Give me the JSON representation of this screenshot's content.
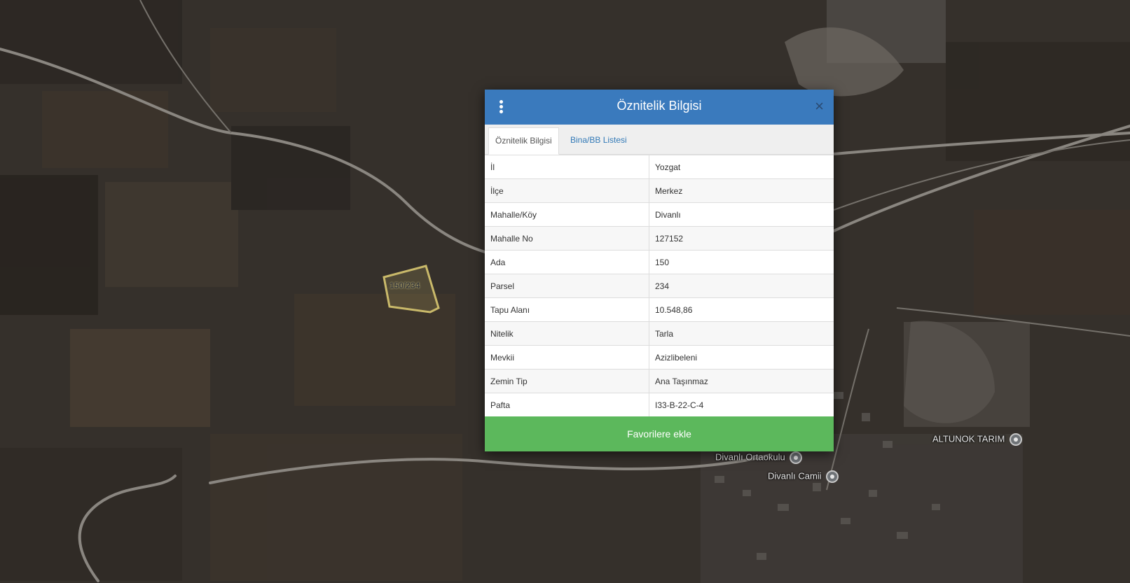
{
  "map": {
    "parcel_label": "150/234",
    "poi": [
      {
        "label": "ALTUNOK TARIM"
      },
      {
        "label": "Divanlı Ortaokulu"
      },
      {
        "label": "Divanlı Camii"
      }
    ]
  },
  "modal": {
    "title": "Öznitelik Bilgisi",
    "close_symbol": "×",
    "tabs": [
      {
        "label": "Öznitelik Bilgisi",
        "active": true
      },
      {
        "label": "Bina/BB Listesi",
        "active": false
      }
    ],
    "rows": [
      {
        "key": "İl",
        "value": "Yozgat"
      },
      {
        "key": "İlçe",
        "value": "Merkez"
      },
      {
        "key": "Mahalle/Köy",
        "value": "Divanlı"
      },
      {
        "key": "Mahalle No",
        "value": "127152"
      },
      {
        "key": "Ada",
        "value": "150"
      },
      {
        "key": "Parsel",
        "value": "234"
      },
      {
        "key": "Tapu Alanı",
        "value": "10.548,86"
      },
      {
        "key": "Nitelik",
        "value": "Tarla"
      },
      {
        "key": "Mevkii",
        "value": "Azizlibeleni"
      },
      {
        "key": "Zemin Tip",
        "value": "Ana Taşınmaz"
      },
      {
        "key": "Pafta",
        "value": "I33-B-22-C-4"
      }
    ],
    "favorite_button": "Favorilere ekle"
  },
  "colors": {
    "header": "#3a7abd",
    "button": "#5cb85c",
    "parcel_outline": "#c9b96a"
  }
}
